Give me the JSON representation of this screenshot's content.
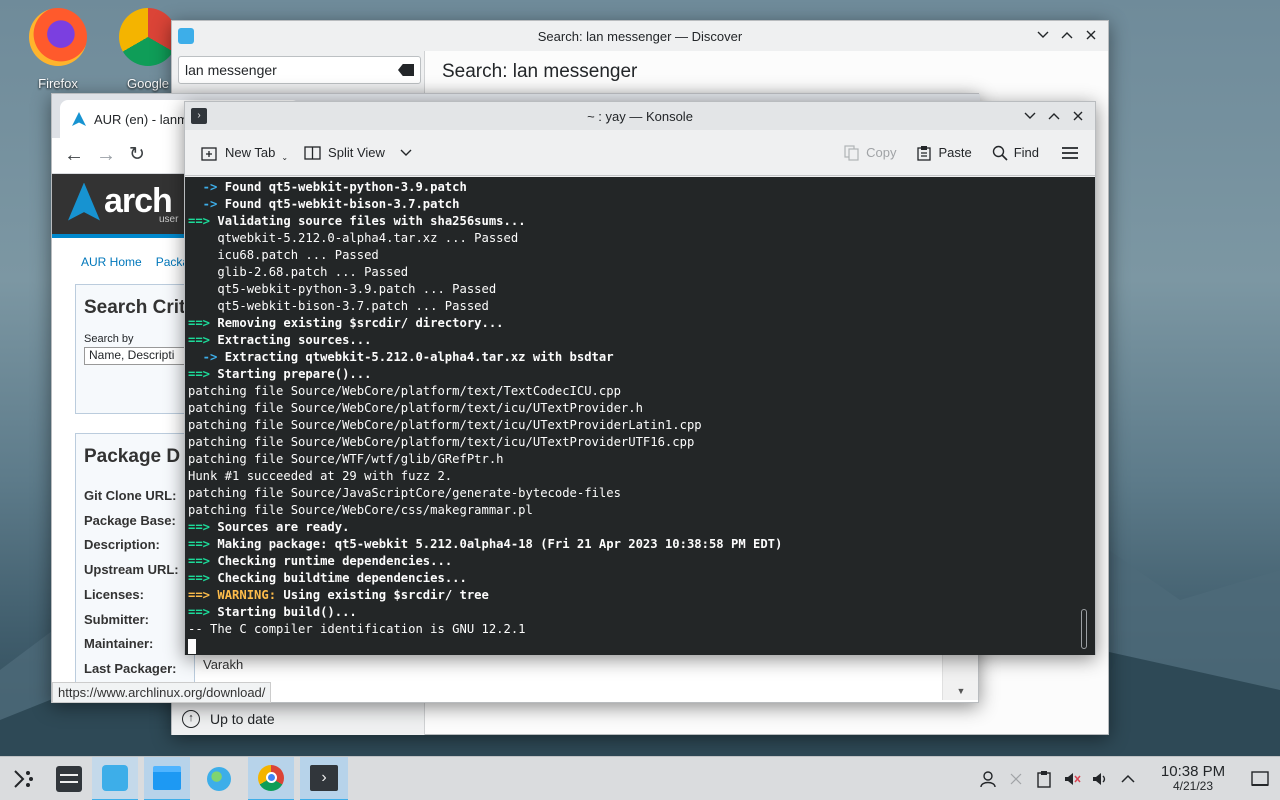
{
  "desktop": {
    "icons": [
      {
        "label": "Firefox"
      },
      {
        "label": "Google"
      }
    ]
  },
  "discover": {
    "title": "Search: lan messenger — Discover",
    "search_value": "lan messenger",
    "heading": "Search: lan messenger",
    "status": "Up to date"
  },
  "browser": {
    "tab_title": "AUR (en) - lanm",
    "logo_text": "arch",
    "logo_sub": "user",
    "nav": [
      "AUR Home",
      "Packa"
    ],
    "search_heading": "Search Crit",
    "search_by_label": "Search by",
    "search_by_value": "Name, Descripti",
    "details_heading": "Package D",
    "fields": [
      {
        "label": "Git Clone URL:",
        "value": ""
      },
      {
        "label": "Package Base:",
        "value": ""
      },
      {
        "label": "Description:",
        "value": ""
      },
      {
        "label": "Upstream URL:",
        "value": ""
      },
      {
        "label": "Licenses:",
        "value": ""
      },
      {
        "label": "Submitter:",
        "value": ""
      },
      {
        "label": "Maintainer:",
        "value": ""
      },
      {
        "label": "Last Packager:",
        "value": "Varakh"
      }
    ],
    "status_url": "https://www.archlinux.org/download/"
  },
  "konsole": {
    "title": "~ : yay — Konsole",
    "toolbar": {
      "new_tab": "New Tab",
      "split_view": "Split View",
      "copy": "Copy",
      "paste": "Paste",
      "find": "Find"
    },
    "lines": [
      [
        {
          "t": "  -> ",
          "c": "c"
        },
        {
          "t": "Found qt5-webkit-python-3.9.patch",
          "c": "b"
        }
      ],
      [
        {
          "t": "  -> ",
          "c": "c"
        },
        {
          "t": "Found qt5-webkit-bison-3.7.patch",
          "c": "b"
        }
      ],
      [
        {
          "t": "==> ",
          "c": "g"
        },
        {
          "t": "Validating source files with sha256sums...",
          "c": "b"
        }
      ],
      [
        {
          "t": "    qtwebkit-5.212.0-alpha4.tar.xz ... Passed",
          "c": ""
        }
      ],
      [
        {
          "t": "    icu68.patch ... Passed",
          "c": ""
        }
      ],
      [
        {
          "t": "    glib-2.68.patch ... Passed",
          "c": ""
        }
      ],
      [
        {
          "t": "    qt5-webkit-python-3.9.patch ... Passed",
          "c": ""
        }
      ],
      [
        {
          "t": "    qt5-webkit-bison-3.7.patch ... Passed",
          "c": ""
        }
      ],
      [
        {
          "t": "==> ",
          "c": "g"
        },
        {
          "t": "Removing existing $srcdir/ directory...",
          "c": "b"
        }
      ],
      [
        {
          "t": "==> ",
          "c": "g"
        },
        {
          "t": "Extracting sources...",
          "c": "b"
        }
      ],
      [
        {
          "t": "  -> ",
          "c": "c"
        },
        {
          "t": "Extracting qtwebkit-5.212.0-alpha4.tar.xz with bsdtar",
          "c": "b"
        }
      ],
      [
        {
          "t": "==> ",
          "c": "g"
        },
        {
          "t": "Starting prepare()...",
          "c": "b"
        }
      ],
      [
        {
          "t": "patching file Source/WebCore/platform/text/TextCodecICU.cpp",
          "c": ""
        }
      ],
      [
        {
          "t": "patching file Source/WebCore/platform/text/icu/UTextProvider.h",
          "c": ""
        }
      ],
      [
        {
          "t": "patching file Source/WebCore/platform/text/icu/UTextProviderLatin1.cpp",
          "c": ""
        }
      ],
      [
        {
          "t": "patching file Source/WebCore/platform/text/icu/UTextProviderUTF16.cpp",
          "c": ""
        }
      ],
      [
        {
          "t": "patching file Source/WTF/wtf/glib/GRefPtr.h",
          "c": ""
        }
      ],
      [
        {
          "t": "Hunk #1 succeeded at 29 with fuzz 2.",
          "c": ""
        }
      ],
      [
        {
          "t": "patching file Source/JavaScriptCore/generate-bytecode-files",
          "c": ""
        }
      ],
      [
        {
          "t": "patching file Source/WebCore/css/makegrammar.pl",
          "c": ""
        }
      ],
      [
        {
          "t": "==> ",
          "c": "g"
        },
        {
          "t": "Sources are ready.",
          "c": "b"
        }
      ],
      [
        {
          "t": "==> ",
          "c": "g"
        },
        {
          "t": "Making package: qt5-webkit 5.212.0alpha4-18 (Fri 21 Apr 2023 10:38:58 PM EDT)",
          "c": "b"
        }
      ],
      [
        {
          "t": "==> ",
          "c": "g"
        },
        {
          "t": "Checking runtime dependencies...",
          "c": "b"
        }
      ],
      [
        {
          "t": "==> ",
          "c": "g"
        },
        {
          "t": "Checking buildtime dependencies...",
          "c": "b"
        }
      ],
      [
        {
          "t": "==> ",
          "c": "y"
        },
        {
          "t": "WARNING:",
          "c": "y"
        },
        {
          "t": " Using existing $srcdir/ tree",
          "c": "b"
        }
      ],
      [
        {
          "t": "==> ",
          "c": "g"
        },
        {
          "t": "Starting build()...",
          "c": "b"
        }
      ],
      [
        {
          "t": "-- The C compiler identification is GNU 12.2.1",
          "c": ""
        }
      ]
    ]
  },
  "taskbar": {
    "apps": [
      "app-launcher-icon",
      "system-settings-icon",
      "discover-icon",
      "file-manager-icon",
      "globe-icon",
      "chrome-icon",
      "konsole-icon"
    ],
    "time": "10:38 PM",
    "date": "4/21/23"
  },
  "colors": {
    "accent": "#3daee9",
    "terminal_bg": "#232627",
    "prompt_green": "#1cdc9a",
    "warning": "#fdbc4b"
  }
}
